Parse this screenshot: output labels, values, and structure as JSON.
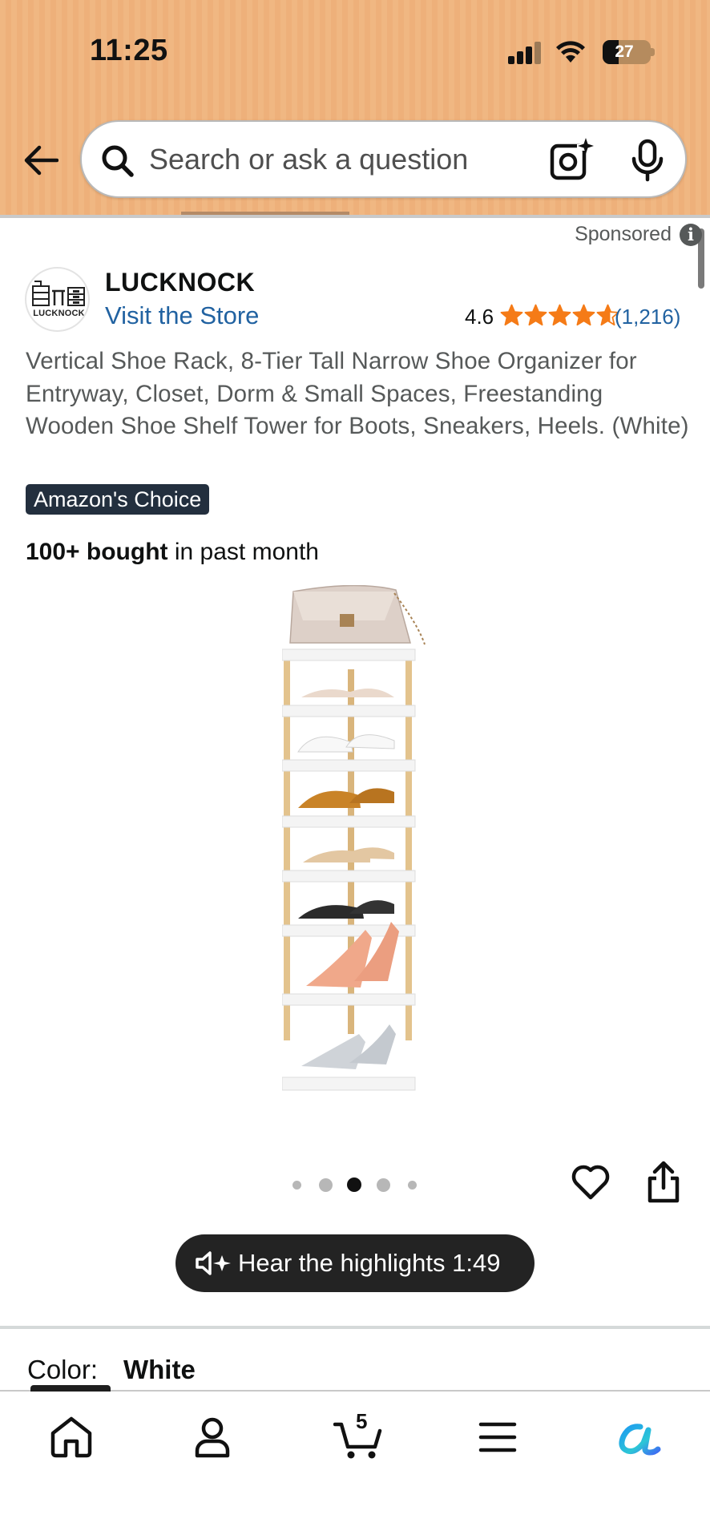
{
  "status_bar": {
    "time": "11:25",
    "battery": "27"
  },
  "search": {
    "placeholder": "Search or ask a question"
  },
  "sponsored": {
    "label": "Sponsored",
    "info": "i"
  },
  "brand": {
    "name": "LUCKNOCK",
    "logo_text": "LUCKNOCK",
    "visit_store": "Visit the Store",
    "rating": "4.6",
    "rating_stars": 4.6,
    "rating_count": "(1,216)"
  },
  "product": {
    "title": "Vertical Shoe Rack, 8-Tier Tall Narrow Shoe Organizer for Entryway, Closet, Dorm & Small Spaces, Freestanding Wooden Shoe Shelf Tower for Boots, Sneakers, Heels. (White)",
    "badge": "Amazon's Choice",
    "bought_bold": "100+ bought",
    "bought_rest": " in past month"
  },
  "carousel": {
    "dot_count": 5,
    "active_index": 2
  },
  "highlights": {
    "label": "Hear the highlights 1:49"
  },
  "variation": {
    "label": "Color:",
    "value": "White"
  },
  "bottom_nav": {
    "cart_count": "5",
    "items": [
      "home-icon",
      "account-icon",
      "cart-icon",
      "menu-icon",
      "rufus-icon"
    ]
  },
  "colors": {
    "header": "#f0b782",
    "link": "#2162a1",
    "star": "#f57b17",
    "badge_bg": "#232f3e"
  }
}
